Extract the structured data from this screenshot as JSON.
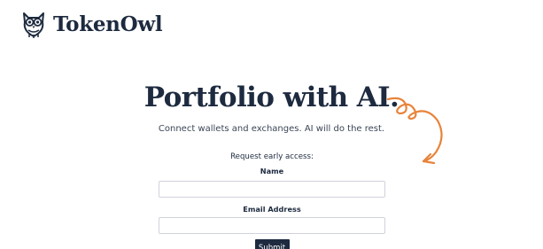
{
  "brand": {
    "name": "TokenOwl",
    "logo_icon": "owl-icon"
  },
  "hero": {
    "title_first_word": "Portfolio",
    "title_rest": " with AI.",
    "subtitle": "Connect wallets and exchanges. AI will do the rest."
  },
  "form": {
    "lead": "Request early access:",
    "name_label": "Name",
    "name_value": "",
    "email_label": "Email Address",
    "email_value": "",
    "submit_label": "Submit"
  },
  "colors": {
    "navy": "#1d2a3f",
    "accent_orange": "#e8833a",
    "underline_peach": "#f4c4a1"
  }
}
